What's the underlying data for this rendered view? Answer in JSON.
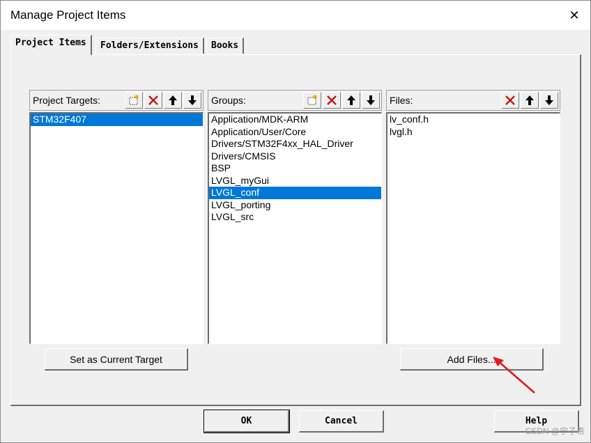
{
  "window": {
    "title": "Manage Project Items",
    "close_glyph": "✕"
  },
  "tabs": [
    {
      "label": "Project Items",
      "active": true
    },
    {
      "label": "Folders/Extensions",
      "active": false
    },
    {
      "label": "Books",
      "active": false
    }
  ],
  "targets": {
    "label": "Project Targets:",
    "items": [
      "STM32F407"
    ],
    "selected_index": 0,
    "tools": [
      "new-icon",
      "delete-icon",
      "move-up-icon",
      "move-down-icon"
    ]
  },
  "groups": {
    "label": "Groups:",
    "items": [
      "Application/MDK-ARM",
      "Application/User/Core",
      "Drivers/STM32F4xx_HAL_Driver",
      "Drivers/CMSIS",
      "BSP",
      "LVGL_myGui",
      "LVGL_conf",
      "LVGL_porting",
      "LVGL_src"
    ],
    "selected_index": 6,
    "tools": [
      "new-icon",
      "delete-icon",
      "move-up-icon",
      "move-down-icon"
    ]
  },
  "files": {
    "label": "Files:",
    "items": [
      "lv_conf.h",
      "lvgl.h"
    ],
    "tools": [
      "delete-icon",
      "move-up-icon",
      "move-down-icon"
    ]
  },
  "buttons": {
    "set_current_target": "Set as Current Target",
    "add_files": "Add Files...",
    "ok": "OK",
    "cancel": "Cancel",
    "help": "Help"
  },
  "watermark": "CSDN @宁子希",
  "colors": {
    "selection": "#0078d7",
    "annotation_arrow": "#e21b1b",
    "delete_icon": "#c01818"
  }
}
